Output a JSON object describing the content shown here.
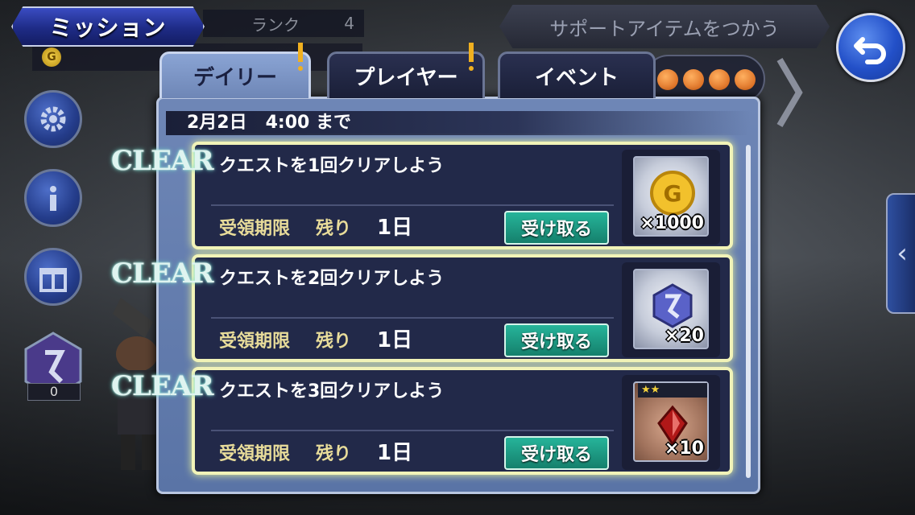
{
  "header": {
    "title": "ミッション",
    "rank_label": "ランク",
    "rank_value": "4",
    "gil_icon": "G",
    "support_label": "サポートアイテムをつかう"
  },
  "sidebar": {
    "crystal_count": "0"
  },
  "tabs": [
    {
      "label": "デイリー",
      "active": true,
      "alert": true
    },
    {
      "label": "プレイヤー",
      "active": false,
      "alert": true
    },
    {
      "label": "イベント",
      "active": false,
      "alert": false
    }
  ],
  "deadline": {
    "date": "2月2日",
    "time": "4:00",
    "suffix": "まで"
  },
  "missions": [
    {
      "status": "CLEAR",
      "title": "クエストを1回クリアしよう",
      "expire_label": "受領期限",
      "remain_label": "残り",
      "remain_value": "1日",
      "claim_label": "受け取る",
      "reward": {
        "icon": "gil-coin-icon",
        "coin_letter": "G",
        "quantity": "×1000"
      }
    },
    {
      "status": "CLEAR",
      "title": "クエストを2回クリアしよう",
      "expire_label": "受領期限",
      "remain_label": "残り",
      "remain_value": "1日",
      "claim_label": "受け取る",
      "reward": {
        "icon": "crystal-emblem-icon",
        "quantity": "×20"
      }
    },
    {
      "status": "CLEAR",
      "title": "クエストを3回クリアしよう",
      "expire_label": "受領期限",
      "remain_label": "残り",
      "remain_value": "1日",
      "claim_label": "受け取る",
      "reward": {
        "icon": "red-gem-icon",
        "stars": "★★",
        "quantity": "×10"
      }
    }
  ],
  "colors": {
    "accent_blue": "#2350c8",
    "claim_green": "#26b49a",
    "card_glow": "#f1f3b8",
    "label_gold": "#e8dc9a"
  }
}
